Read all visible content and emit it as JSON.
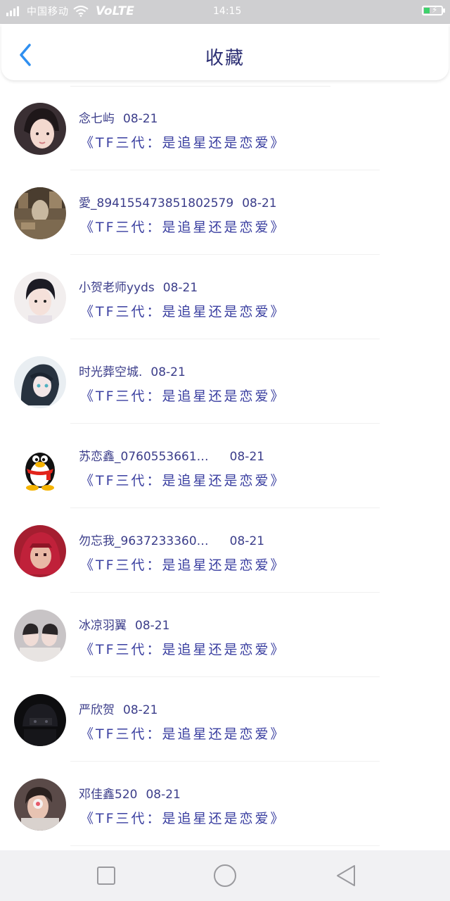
{
  "status_bar": {
    "carrier": "中国移动",
    "network": "VoLTE",
    "time": "14:15"
  },
  "header": {
    "title": "收藏",
    "back_icon": "chevron-left-icon"
  },
  "favorites": [
    {
      "user": "念七屿",
      "date": "08-21",
      "title": "《TF三代：是追星还是恋爱》"
    },
    {
      "user": "愛_8941554738518025​79",
      "date": "08-21",
      "title": "《TF三代：是追星还是恋爱》"
    },
    {
      "user": "小贺老师yyds",
      "date": "08-21",
      "title": "《TF三代：是追星还是恋爱》"
    },
    {
      "user": "时光葬空城.",
      "date": "08-21",
      "title": "《TF三代：是追星还是恋爱》"
    },
    {
      "user": "苏恋鑫_0760553661…",
      "date": "08-21",
      "title": "《TF三代：是追星还是恋爱》"
    },
    {
      "user": "勿忘我_9637233360…",
      "date": "08-21",
      "title": "《TF三代：是追星还是恋爱》"
    },
    {
      "user": "冰凉羽翼",
      "date": "08-21",
      "title": "《TF三代：是追星还是恋爱》"
    },
    {
      "user": "严欣贺",
      "date": "08-21",
      "title": "《TF三代：是追星还是恋爱》"
    },
    {
      "user": "邓佳鑫520",
      "date": "08-21",
      "title": "《TF三代：是追星还是恋爱》"
    }
  ],
  "colors": {
    "accent": "#2f8ff0",
    "title_text": "#2b2e73",
    "list_text": "#3a3fa0"
  },
  "nav_bar": {
    "recent_icon": "square-icon",
    "home_icon": "circle-icon",
    "back_icon": "triangle-back-icon"
  }
}
